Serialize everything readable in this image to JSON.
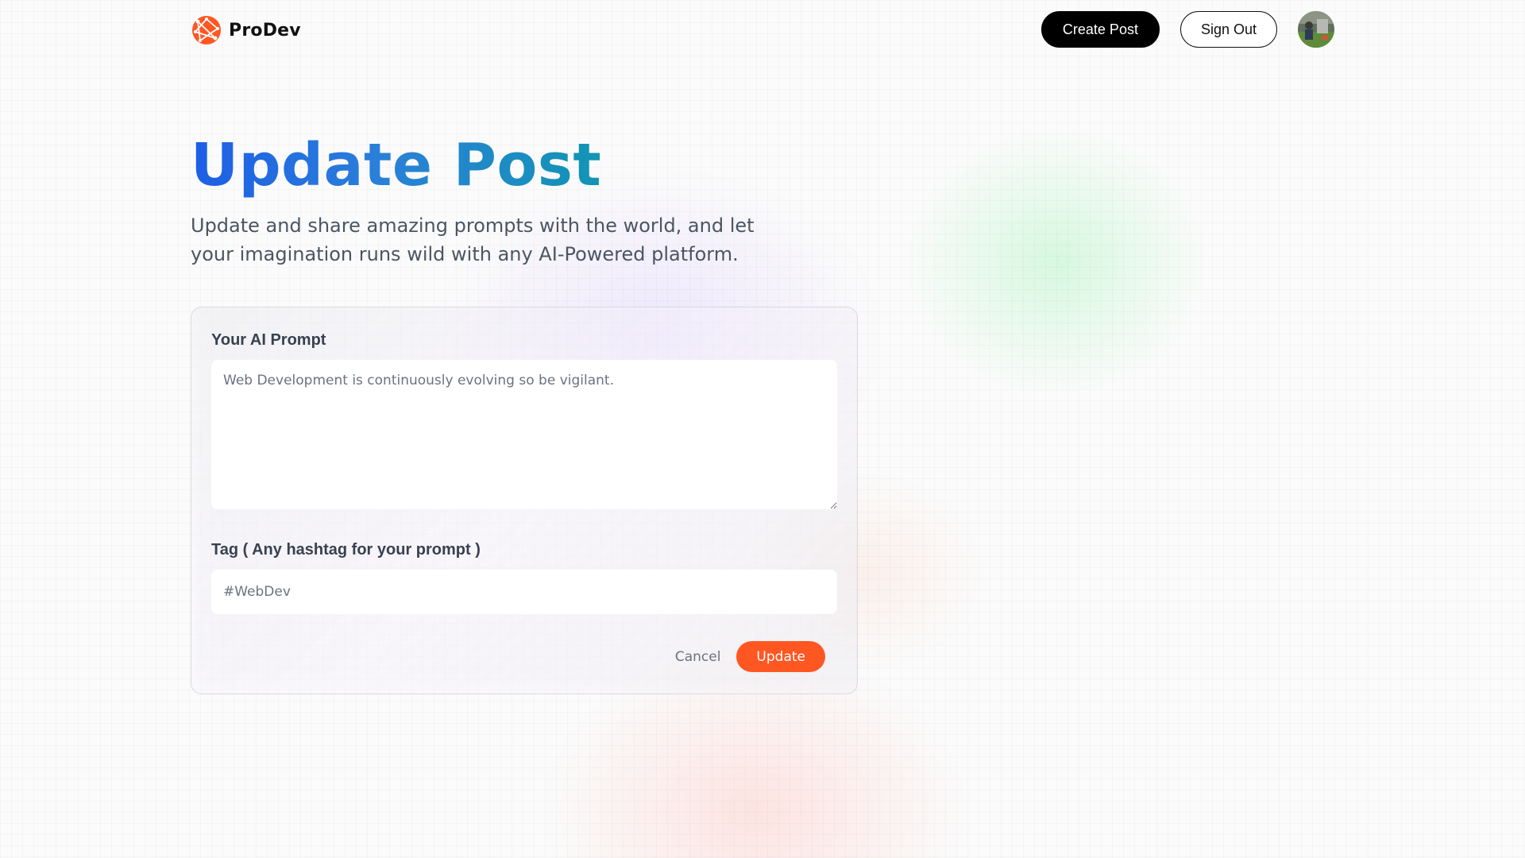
{
  "header": {
    "brand_name": "ProDev",
    "logo_icon": "globe-logo-icon",
    "create_post_label": "Create Post",
    "sign_out_label": "Sign Out",
    "avatar_icon": "user-avatar"
  },
  "hero": {
    "title": "Update Post",
    "subtitle": "Update and share amazing prompts with the world, and let your imagination runs wild with any AI-Powered platform."
  },
  "form": {
    "prompt_label": "Your AI Prompt",
    "prompt_value": "Web Development is continuously evolving so be vigilant.",
    "tag_label": "Tag ( Any hashtag for your prompt )",
    "tag_value": "#WebDev",
    "cancel_label": "Cancel",
    "submit_label": "Update"
  },
  "colors": {
    "accent": "#ff5722",
    "title_gradient_start": "#1d5ee6",
    "title_gradient_end": "#1295b3",
    "primary_button": "#000000"
  }
}
